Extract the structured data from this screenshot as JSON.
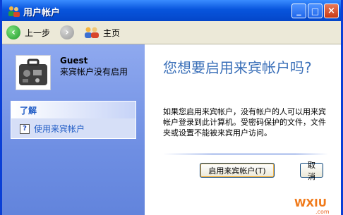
{
  "window": {
    "title": "用户帐户"
  },
  "titlebar_buttons": {
    "minimize": "_",
    "maximize": "□",
    "close": "×"
  },
  "toolbar": {
    "back_label": "上一步",
    "home_label": "主页"
  },
  "user": {
    "name": "Guest",
    "status": "来宾帐户没有启用"
  },
  "panel": {
    "title": "了解",
    "link_label": "使用来宾帐户"
  },
  "main": {
    "heading": "您想要启用来宾帐户吗?",
    "description": "如果您启用来宾帐户，没有帐户的人可以用来宾帐户登录到此计算机。受密码保护的文件，文件夹或设置不能被来宾用户访问。"
  },
  "buttons": {
    "enable": "启用来宾帐户(T)",
    "cancel": "取消"
  },
  "watermark": {
    "text": "WXIU.com"
  },
  "colors": {
    "titlebar": "#0855dd",
    "leftpane": "#7a96e6",
    "heading": "#3a6fb8",
    "link": "#215dc6"
  }
}
